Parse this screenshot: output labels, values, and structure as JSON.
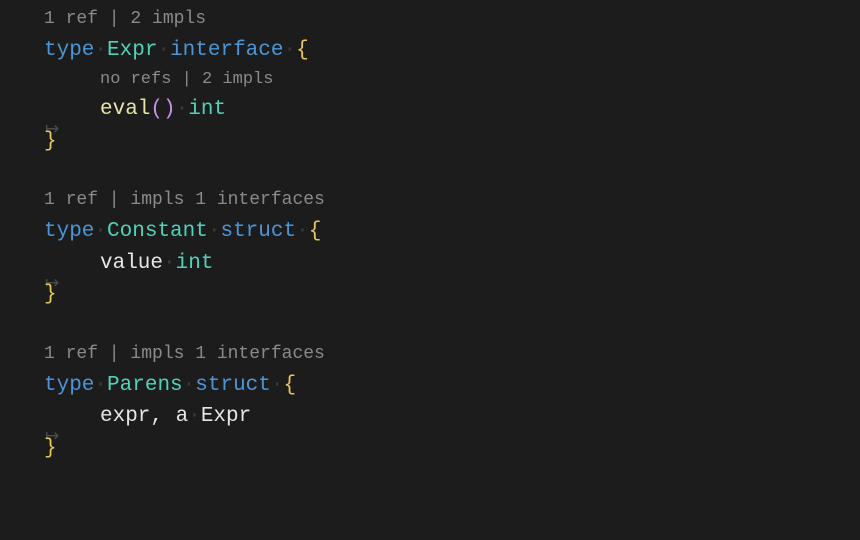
{
  "blocks": [
    {
      "codelens": "1 ref | 2 impls",
      "decl": {
        "kw1": "type",
        "name": "Expr",
        "kw2": "interface",
        "open": "{"
      },
      "inner_codelens": "no refs | 2 impls",
      "member": {
        "name": "eval",
        "parens": "()",
        "ret": "int"
      },
      "close": "}"
    },
    {
      "codelens": "1 ref | impls 1 interfaces",
      "decl": {
        "kw1": "type",
        "name": "Constant",
        "kw2": "struct",
        "open": "{"
      },
      "field": {
        "ident": "value",
        "type": "int"
      },
      "close": "}"
    },
    {
      "codelens": "1 ref | impls 1 interfaces",
      "decl": {
        "kw1": "type",
        "name": "Parens",
        "kw2": "struct",
        "open": "{"
      },
      "field": {
        "ident": "expr, a",
        "type": "Expr"
      },
      "close": "}"
    }
  ],
  "glyphs": {
    "indent_arrow": "↦"
  }
}
